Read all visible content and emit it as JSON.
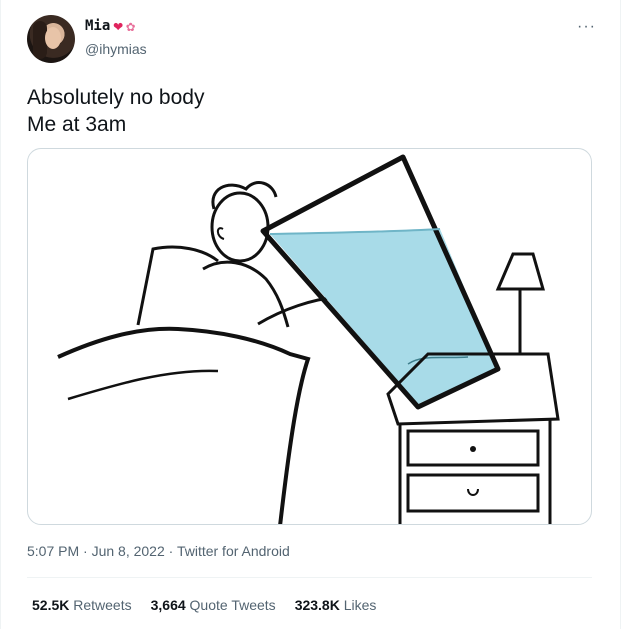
{
  "author": {
    "display_name": "Mia",
    "handle": "@ihymias",
    "avatar_icon": "profile-photo",
    "heart_glyph": "❤",
    "flower_glyph": "✿"
  },
  "more_icon": "···",
  "tweet": {
    "line1": "Absolutely no body",
    "line2": "Me at 3am"
  },
  "meta": {
    "timestamp": "5:07 PM · Jun 8, 2022 · Twitter for Android"
  },
  "stats": {
    "retweets_count": "52.5K",
    "retweets_label": "Retweets",
    "quotes_count": "3,664",
    "quotes_label": "Quote Tweets",
    "likes_count": "323.8K",
    "likes_label": "Likes"
  },
  "colors": {
    "text": "#0f1419",
    "secondary": "#536471",
    "border": "#cfd9de",
    "water": "#a8dbe8",
    "heart": "#e0245e"
  }
}
